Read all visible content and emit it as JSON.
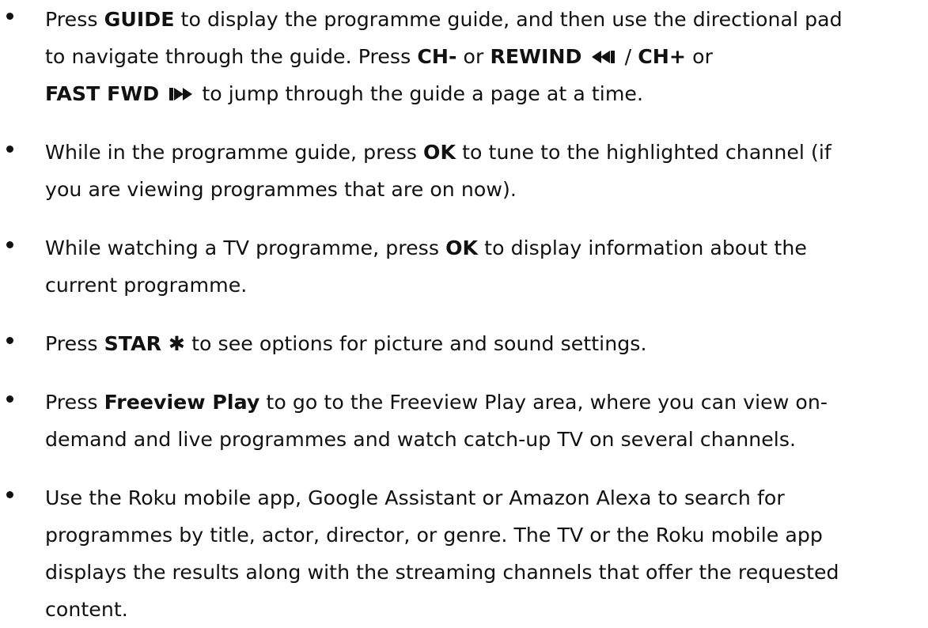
{
  "items": [
    {
      "lines": [
        [
          "Press ",
          {
            "b": "GUIDE"
          },
          " to display the programme guide, and then use the directional pad"
        ],
        [
          "to navigate through the guide. Press ",
          {
            "b": "CH-"
          },
          " or ",
          {
            "b": "REWIND"
          },
          " ",
          {
            "icon": "rewind-icon"
          },
          " / ",
          {
            "b": "CH+"
          },
          " or"
        ],
        [
          {
            "b": "FAST FWD"
          },
          " ",
          {
            "icon": "fast-forward-icon"
          },
          " to jump through the guide a page at a time."
        ]
      ]
    },
    {
      "lines": [
        [
          "While in the programme guide, press ",
          {
            "b": "OK"
          },
          " to tune to the highlighted channel (if"
        ],
        [
          "you are viewing programmes that are on now)."
        ]
      ]
    },
    {
      "lines": [
        [
          "While watching a TV programme, press ",
          {
            "b": "OK"
          },
          " to display information about the"
        ],
        [
          "current programme."
        ]
      ]
    },
    {
      "lines": [
        [
          "Press ",
          {
            "b": "STAR ✱"
          },
          " to see options for picture and sound settings."
        ]
      ]
    },
    {
      "lines": [
        [
          "Press ",
          {
            "b": "Freeview Play"
          },
          " to go to the Freeview Play area, where you can view on-"
        ],
        [
          "demand and live programmes and watch catch-up TV on several channels."
        ]
      ]
    },
    {
      "lines": [
        [
          "Use the Roku mobile app, Google Assistant or Amazon Alexa to search for"
        ],
        [
          "programmes by title, actor, director, or genre. The TV or the Roku mobile app"
        ],
        [
          "displays the results along with the streaming channels that offer the requested"
        ],
        [
          "content."
        ]
      ]
    }
  ]
}
